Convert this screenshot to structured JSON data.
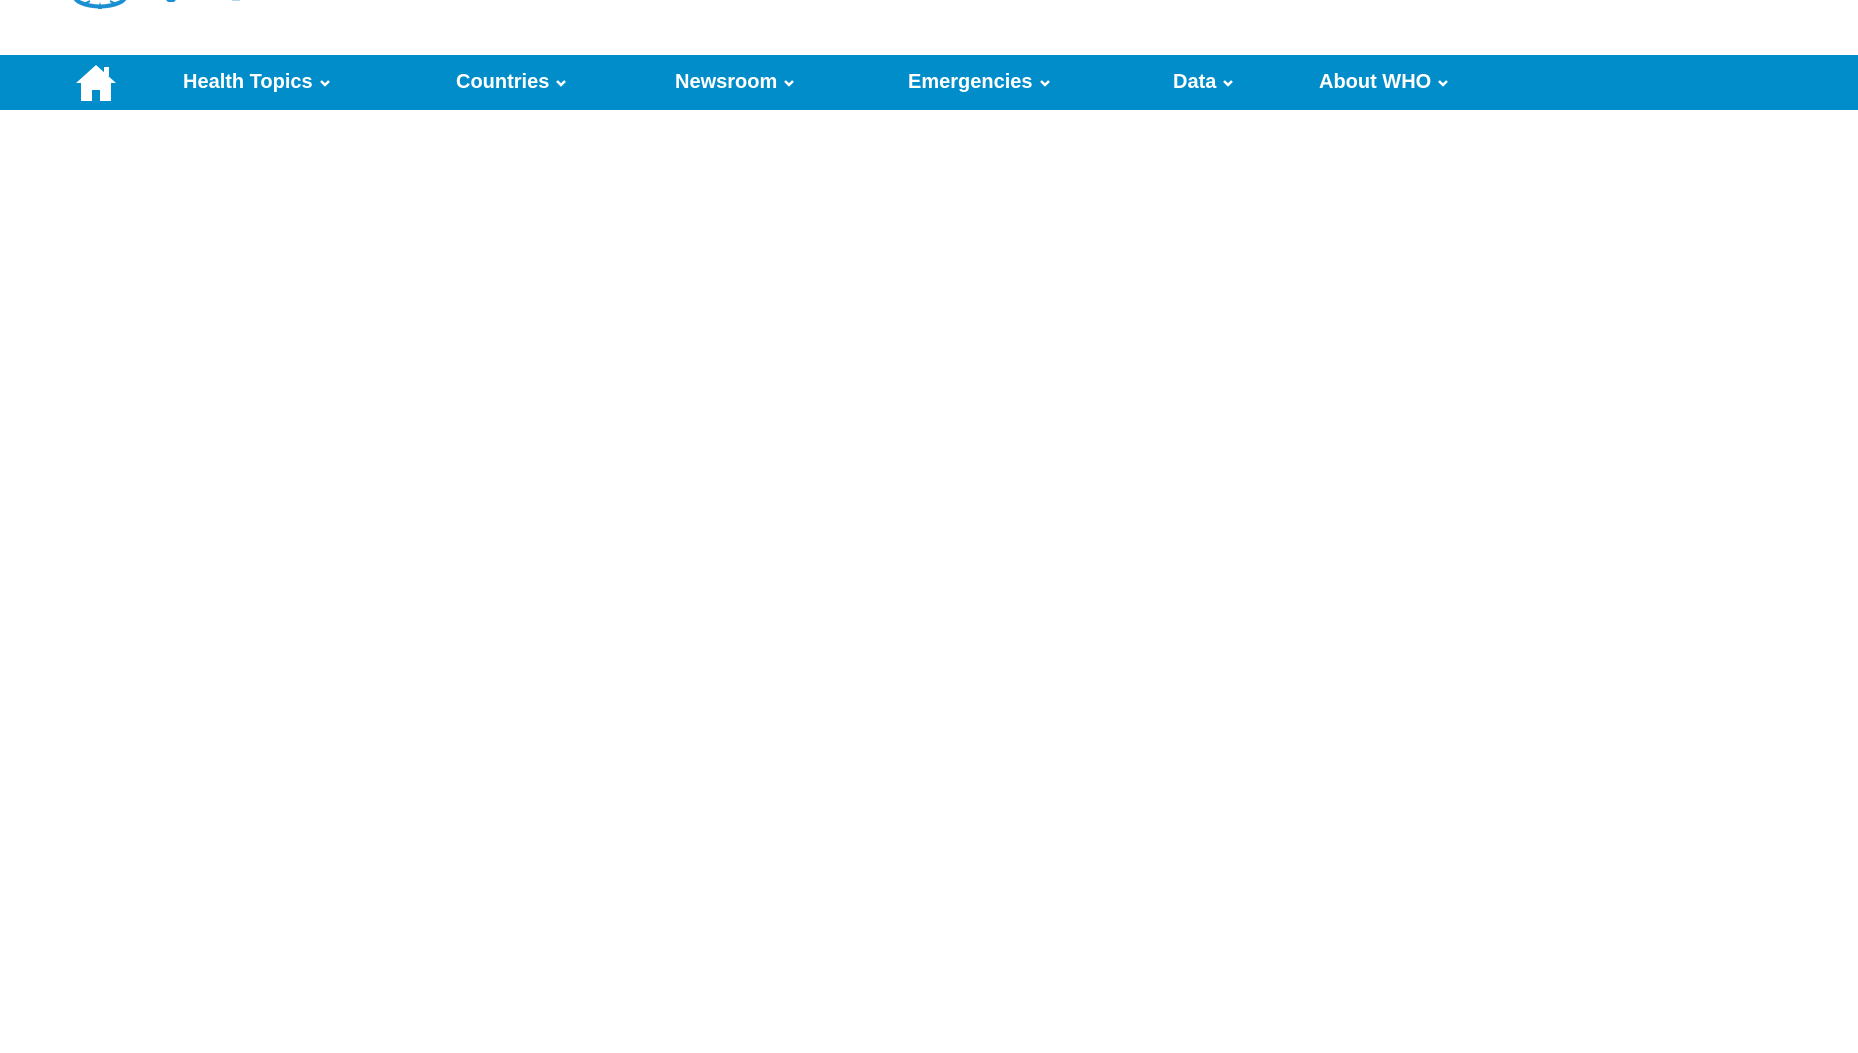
{
  "colors": {
    "nav_background": "#008dc9",
    "nav_text": "#ffffff",
    "logo_blue": "#1a8fd1",
    "page_background": "#ffffff"
  },
  "header": {
    "logo_icon": "who-emblem-icon"
  },
  "nav": {
    "home_icon": "home-icon",
    "items": [
      {
        "label": "Health Topics",
        "icon": "chevron-down-icon"
      },
      {
        "label": "Countries",
        "icon": "chevron-down-icon"
      },
      {
        "label": "Newsroom",
        "icon": "chevron-down-icon"
      },
      {
        "label": "Emergencies",
        "icon": "chevron-down-icon"
      },
      {
        "label": "Data",
        "icon": "chevron-down-icon"
      },
      {
        "label": "About WHO",
        "icon": "chevron-down-icon"
      }
    ]
  }
}
